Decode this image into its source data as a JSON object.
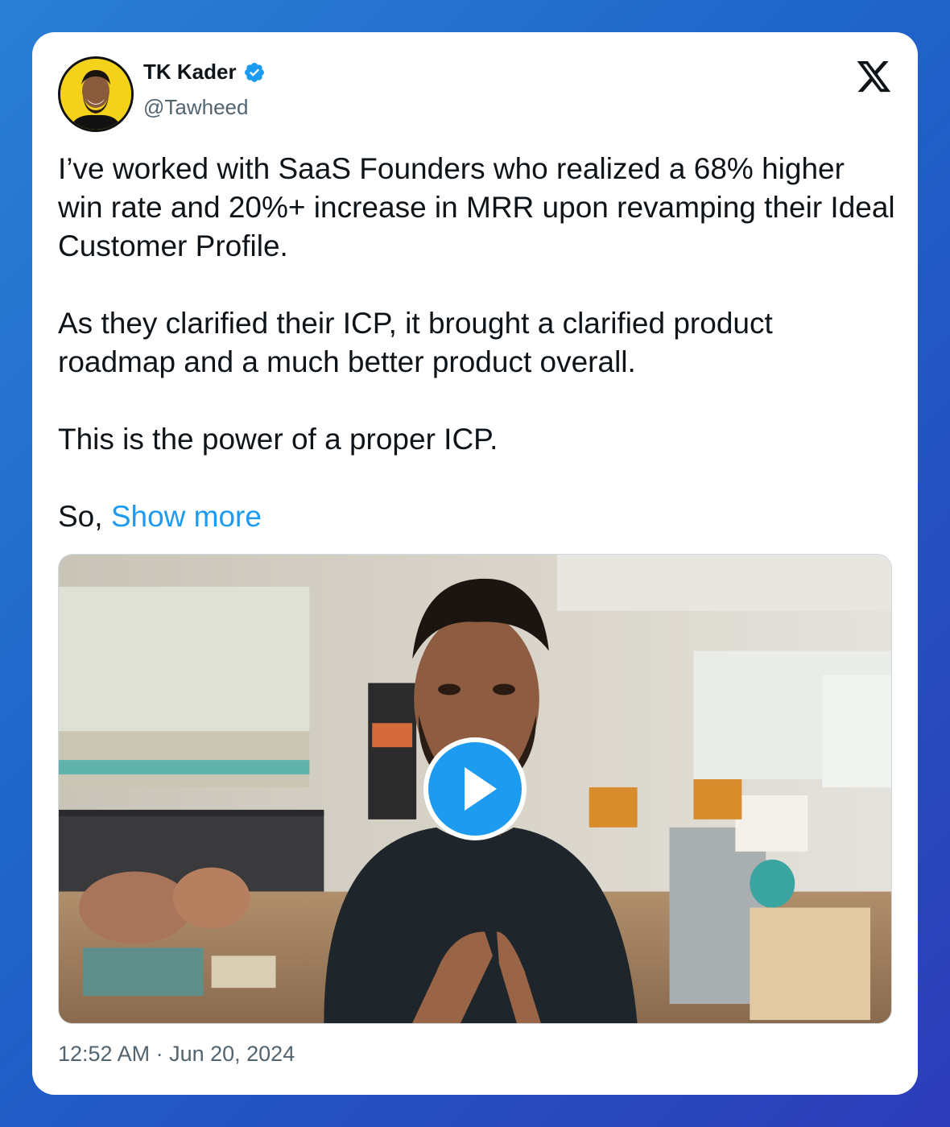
{
  "author": {
    "name": "TK Kader",
    "handle": "@Tawheed",
    "verified": true,
    "avatar_icon": "person-avatar"
  },
  "platform": {
    "logo_icon": "x-logo-icon"
  },
  "tweet": {
    "paragraph_1": "I’ve worked with SaaS Founders who realized a 68% higher win rate and 20%+ increase in MRR upon revamping their Ideal Customer Profile.",
    "paragraph_2": "As they clarified their ICP, it brought a clarified product roadmap and a much better product overall.",
    "paragraph_3": "This is the power of a proper ICP.",
    "paragraph_4_prefix": "So, ",
    "show_more_label": "Show more"
  },
  "media": {
    "type": "video",
    "play_icon": "play-icon"
  },
  "meta": {
    "time": "12:52 AM",
    "separator": " · ",
    "date": "Jun 20, 2024"
  },
  "colors": {
    "link": "#1d9bf0",
    "secondary_text": "#536471",
    "primary_text": "#0f1419",
    "verified_badge": "#1d9bf0",
    "avatar_background": "#f4d21a"
  }
}
